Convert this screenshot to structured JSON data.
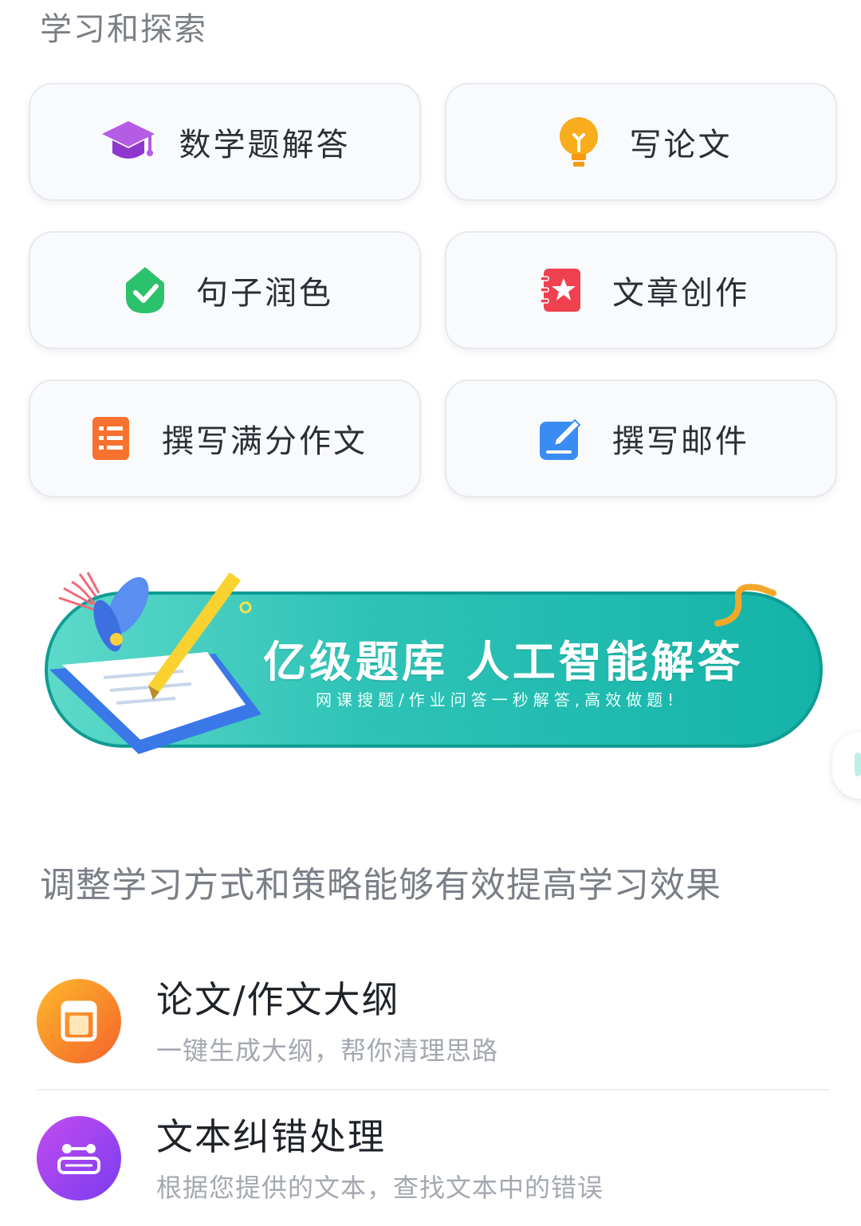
{
  "section": {
    "title": "学习和探索"
  },
  "cards": [
    {
      "label": "数学题解答",
      "icon": "graduation-cap-icon",
      "color": "#a24fd6"
    },
    {
      "label": "写论文",
      "icon": "lightbulb-icon",
      "color": "#f5a516"
    },
    {
      "label": "句子润色",
      "icon": "check-badge-icon",
      "color": "#2cc16b"
    },
    {
      "label": "文章创作",
      "icon": "star-notebook-icon",
      "color": "#f0414f"
    },
    {
      "label": "撰写满分作文",
      "icon": "list-document-icon",
      "color": "#f7722e"
    },
    {
      "label": "撰写邮件",
      "icon": "edit-pen-icon",
      "color": "#3b8cf2"
    }
  ],
  "banner": {
    "title": "亿级题库  人工智能解答",
    "subtitle": "网课搜题/作业问答一秒解答,高效做题!",
    "accent": "#14b3a8"
  },
  "tip": {
    "text": "调整学习方式和策略能够有效提高学习效果"
  },
  "features": [
    {
      "title": "论文/作文大纲",
      "subtitle": "一键生成大纲，帮你清理思路",
      "icon": "notebook-icon",
      "gradient": [
        "#fdb92a",
        "#f5622d"
      ]
    },
    {
      "title": "文本纠错处理",
      "subtitle": "根据您提供的文本，查找文本中的错误",
      "icon": "text-correction-icon",
      "gradient": [
        "#c34cf0",
        "#7a3cef"
      ]
    }
  ]
}
